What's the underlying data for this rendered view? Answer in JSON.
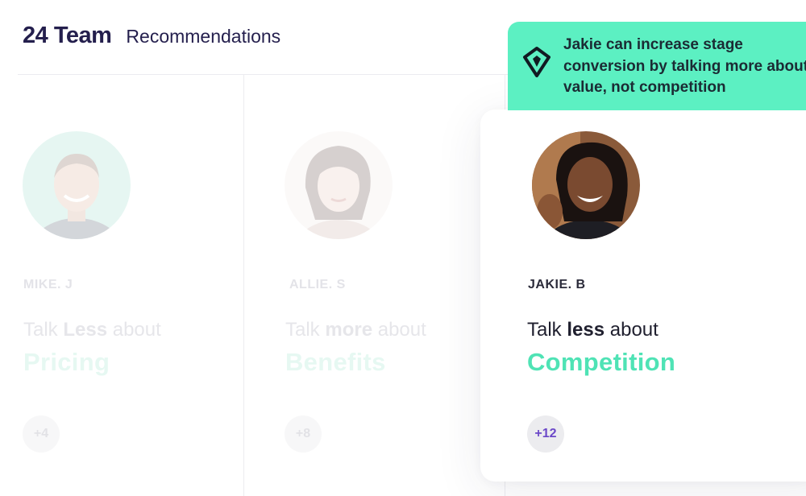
{
  "header": {
    "team_count": "24 Team",
    "subtitle": "Recommendations"
  },
  "cards": [
    {
      "name": "MIKE. J",
      "talk_prefix": "Talk ",
      "talk_emphasis": "Less",
      "talk_suffix": " about",
      "topic": "Pricing",
      "count": "+4",
      "state": "faded"
    },
    {
      "name": "ALLIE. S",
      "talk_prefix": "Talk ",
      "talk_emphasis": "more",
      "talk_suffix": " about",
      "topic": "Benefits",
      "count": "+8",
      "state": "faded"
    },
    {
      "name": "JAKIE. B",
      "talk_prefix": "Talk ",
      "talk_emphasis": "less",
      "talk_suffix": " about",
      "topic": "Competition",
      "count": "+12",
      "state": "featured"
    }
  ],
  "tooltip": {
    "icon": "diamond-logo-icon",
    "text": "Jakie can increase stage conversion by talking more about value, not competition"
  },
  "colors": {
    "brand_dark": "#241f4d",
    "accent_mint": "#5cf0c2",
    "topic_green": "#4fe3b5",
    "count_purple": "#6b48c8"
  }
}
